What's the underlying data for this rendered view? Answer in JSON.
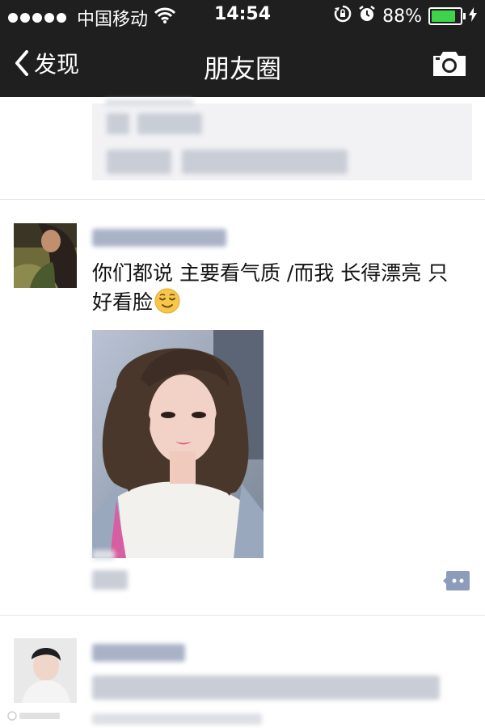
{
  "status_bar": {
    "carrier": "中国移动",
    "time": "14:54",
    "battery_percent": "88%",
    "battery_level": 0.88,
    "icons": [
      "signal-dots-icon",
      "wifi-icon",
      "rotation-lock-icon",
      "alarm-icon",
      "battery-icon",
      "charging-bolt-icon"
    ]
  },
  "nav": {
    "back_label": "发现",
    "title": "朋友圈",
    "right_icon": "camera-icon"
  },
  "posts": [
    {
      "author": "",
      "text": "你们都说 主要看气质 /而我 长得漂亮 只好看脸",
      "emoji": "relieved-face-icon",
      "has_photo": true
    }
  ],
  "colors": {
    "bar_bg": "#1f1f1f",
    "battery_green": "#3ed34a",
    "name_link": "#576b95",
    "comment_button": "#8d9bbc"
  }
}
